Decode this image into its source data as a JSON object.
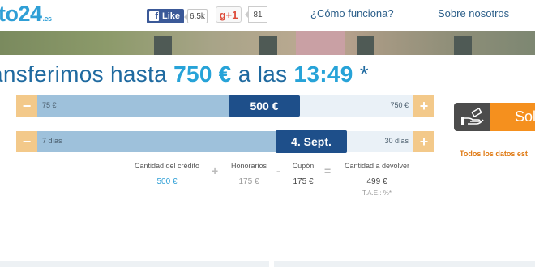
{
  "header": {
    "logo_main": "to24",
    "logo_tld": ".es",
    "facebook": {
      "like_label": "Like",
      "like_count": "6.5k",
      "icon": "facebook-icon"
    },
    "gplus": {
      "label": "g+1",
      "count": "81",
      "icon": "google-plus-icon"
    },
    "nav": [
      {
        "label": "¿Cómo funciona?"
      },
      {
        "label": "Sobre nosotros"
      }
    ]
  },
  "banner": {
    "headline_prefix": "ansferimos hasta",
    "amount": "750 €",
    "headline_mid": "a las",
    "time": "13:49",
    "headline_suffix": "*"
  },
  "sliders": {
    "amount": {
      "minus_label": "−",
      "plus_label": "+",
      "min_label": "75 €",
      "max_label": "750 €",
      "value_label": "500 €",
      "fill_fraction": 0.6
    },
    "term": {
      "minus_label": "−",
      "plus_label": "+",
      "min_label": "7 días",
      "max_label": "30 días",
      "value_label": "4. Sept.",
      "fill_fraction": 0.7
    }
  },
  "costs": {
    "credit": {
      "label": "Cantidad del crédito",
      "value": "500 €"
    },
    "plus_op": "+",
    "fees": {
      "label": "Honorarios",
      "value": "175 €"
    },
    "minus_op": "-",
    "coupon": {
      "label": "Cupón",
      "value": "175 €"
    },
    "eq_op": "=",
    "total": {
      "label": "Cantidad a devolver",
      "value": "499 €"
    },
    "tae": "T.A.E.: %*"
  },
  "cta": {
    "button_label": "Sol",
    "icon": "hand-money-icon",
    "note": "Todos los datos est"
  },
  "colors": {
    "brand_blue": "#1e4f8a",
    "accent_blue": "#27a3d8",
    "orange": "#f5901e"
  }
}
